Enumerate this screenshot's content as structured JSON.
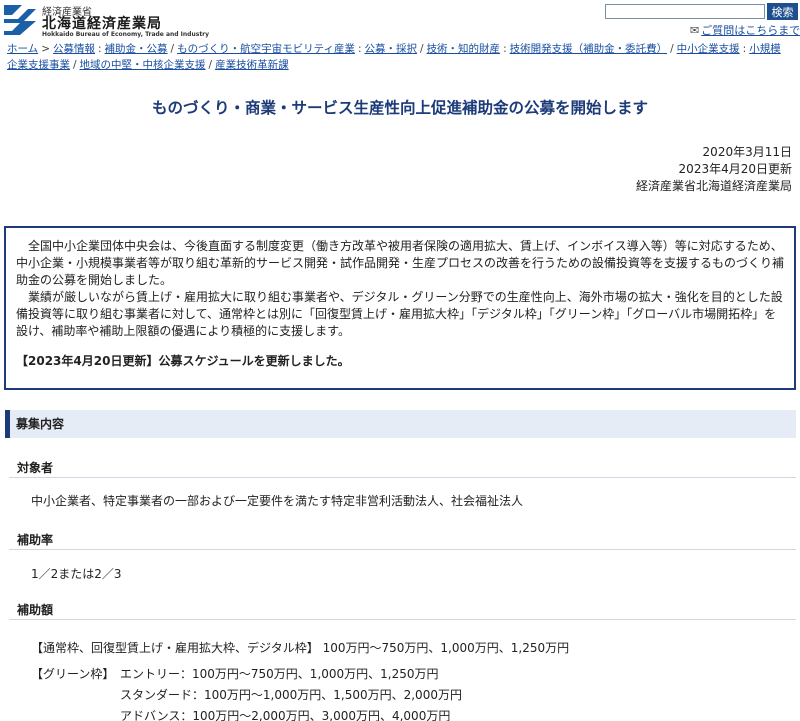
{
  "header": {
    "org_small": "経済産業省",
    "org_name": "北海道経済産業局",
    "org_en": "Hokkaido Bureau of Economy, Trade and Industry",
    "search_placeholder": "",
    "search_button": "検索",
    "contact_link": "ご質問はこちらまで"
  },
  "breadcrumb": {
    "line1": [
      {
        "label": "ホーム",
        "sep": ">"
      },
      {
        "label": "公募情報",
        "sep": ":"
      },
      {
        "label": "補助金・公募",
        "sep": "/"
      },
      {
        "label": "ものづくり・航空宇宙モビリティ産業",
        "sep": ":"
      },
      {
        "label": "公募・採択",
        "sep": "/"
      },
      {
        "label": "技術・知的財産",
        "sep": ":"
      },
      {
        "label": "技術開発支援（補助金・委託費）",
        "sep": "/"
      },
      {
        "label": "中小企業支援",
        "sep": ":"
      },
      {
        "label": "小規模",
        "sep": ""
      }
    ],
    "line2": [
      {
        "label": "企業支援事業",
        "sep": "/"
      },
      {
        "label": "地域の中堅・中核企業支援",
        "sep": "/"
      },
      {
        "label": "産業技術革新課",
        "sep": ""
      }
    ]
  },
  "page_title": "ものづくり・商業・サービス生産性向上促進補助金の公募を開始します",
  "dates": {
    "published": "2020年3月11日",
    "updated": "2023年4月20日更新",
    "author": "経済産業省北海道経済産業局"
  },
  "intro": {
    "para1": "全国中小企業団体中央会は、今後直面する制度変更（働き方改革や被用者保険の適用拡大、賃上げ、インボイス導入等）等に対応するため、中小企業・小規模事業者等が取り組む革新的サービス開発・試作品開発・生産プロセスの改善を行うための設備投資等を支援するものづくり補助金の公募を開始しました。",
    "para2": "業績が厳しいながら賃上げ・雇用拡大に取り組む事業者や、デジタル・グリーン分野での生産性向上、海外市場の拡大・強化を目的とした設備投資等に取り組む事業者に対して、通常枠とは別に「回復型賃上げ・雇用拡大枠」「デジタル枠」「グリーン枠」「グローバル市場開拓枠」を設け、補助率や補助上限額の優遇により積極的に支援します。",
    "update_note": "【2023年4月20日更新】公募スケジュールを更新しました。"
  },
  "section": {
    "title": "募集内容",
    "target_label": "対象者",
    "target_text": "中小企業者、特定事業者の一部および一定要件を満たす特定非営利活動法人、社会福祉法人",
    "rate_label": "補助率",
    "rate_text": "1／2または2／3",
    "amount_label": "補助額",
    "amount_standard": "【通常枠、回復型賃上げ・雇用拡大枠、デジタル枠】 100万円～750万円、1,000万円、1,250万円",
    "green_label": "【グリーン枠】",
    "green_entry": "エントリー：100万円～750万円、1,000万円、1,250万円",
    "green_standard": "スタンダード：100万円～1,000万円、1,500万円、2,000万円",
    "green_advance": "アドバンス：100万円～2,000万円、3,000万円、4,000万円"
  },
  "colors": {
    "brand_navy": "#1d3b78",
    "link": "#1a4fa0",
    "section_bg": "#e6ecf5"
  }
}
